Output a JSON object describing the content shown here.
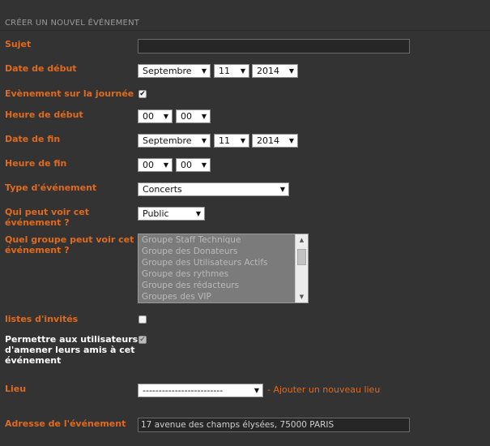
{
  "header": {
    "title": "CRÉER UN NOUVEL ÉVÉNEMENT"
  },
  "fields": {
    "subject": {
      "label": "Sujet",
      "value": ""
    },
    "start_date": {
      "label": "Date de début",
      "month": "Septembre",
      "day": "11",
      "year": "2014"
    },
    "all_day": {
      "label": "Evènement sur la journée",
      "checked": "✔"
    },
    "start_time": {
      "label": "Heure de début",
      "hour": "00",
      "minute": "00"
    },
    "end_date": {
      "label": "Date de fin",
      "month": "Septembre",
      "day": "11",
      "year": "2014"
    },
    "end_time": {
      "label": "Heure de fin",
      "hour": "00",
      "minute": "00"
    },
    "event_type": {
      "label": "Type d'événement",
      "value": "Concerts"
    },
    "visibility": {
      "label_line1": "Qui peut voir cet",
      "label_line2": "événement ?",
      "value": "Public"
    },
    "group_visibility": {
      "label_line1": "Quel groupe peut voir cet",
      "label_line2": "événement ?",
      "options": [
        "Groupe Staff Technique",
        "Groupe des Donateurs",
        "Groupe des Utilisateurs Actifs",
        "Groupe des rythmes",
        "Groupe des rédacteurs",
        "Groupes des VIP"
      ]
    },
    "guest_lists": {
      "label": "listes d'invités"
    },
    "bring_friends": {
      "label_line1": "Permettre aux utilisateurs",
      "label_line2": "d'amener leurs amis à cet",
      "label_line3": "événement",
      "checked": "✔"
    },
    "location": {
      "label": "Lieu",
      "value": "-------------------------",
      "add_link": "- Ajouter un nouveau lieu"
    },
    "address": {
      "label": "Adresse de l'événement",
      "value": "17 avenue des champs élysées, 75000 PARIS"
    }
  },
  "icons": {
    "dropdown": "triangle-down-icon",
    "scroll_up": "scroll-up-icon",
    "scroll_down": "scroll-down-icon"
  },
  "colors": {
    "label_orange": "#e06a1e",
    "background": "#333333"
  }
}
